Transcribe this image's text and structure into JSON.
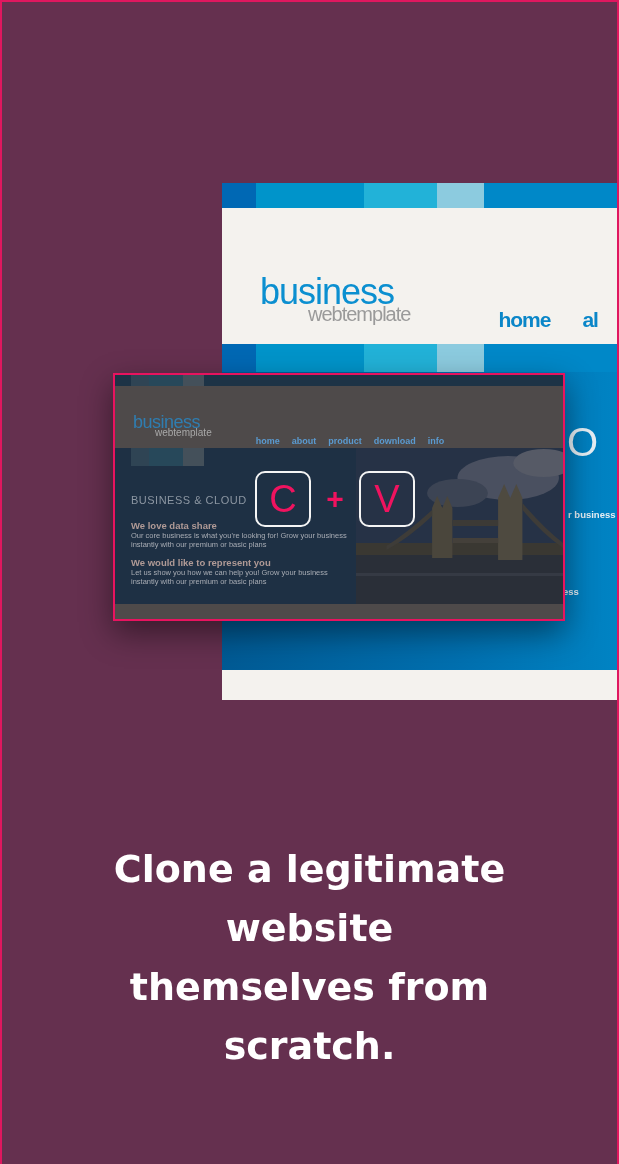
{
  "back_page": {
    "logo": {
      "name": "business",
      "tagline": "webtemplate"
    },
    "nav": [
      "home",
      "al"
    ],
    "heading_fragment": "O",
    "text_fragments": [
      "r business",
      "ess"
    ]
  },
  "copied_page": {
    "logo": {
      "name": "business",
      "tagline": "webtemplate"
    },
    "nav": [
      "home",
      "about",
      "product",
      "download",
      "info"
    ],
    "heading": "BUSINESS & CLOUD",
    "sections": [
      {
        "title": "We love data share",
        "body": "Our core business is what you're looking for! Grow your business instantly with our premium or basic plans"
      },
      {
        "title": "We would like to represent you",
        "body": "Let us show you how we can help you! Grow your business instantly with our premium or basic plans"
      }
    ]
  },
  "shortcut": {
    "keys": [
      "C",
      "V"
    ],
    "joiner": "+"
  },
  "caption": [
    "Clone a legitimate",
    "website",
    "themselves from",
    "scratch."
  ]
}
